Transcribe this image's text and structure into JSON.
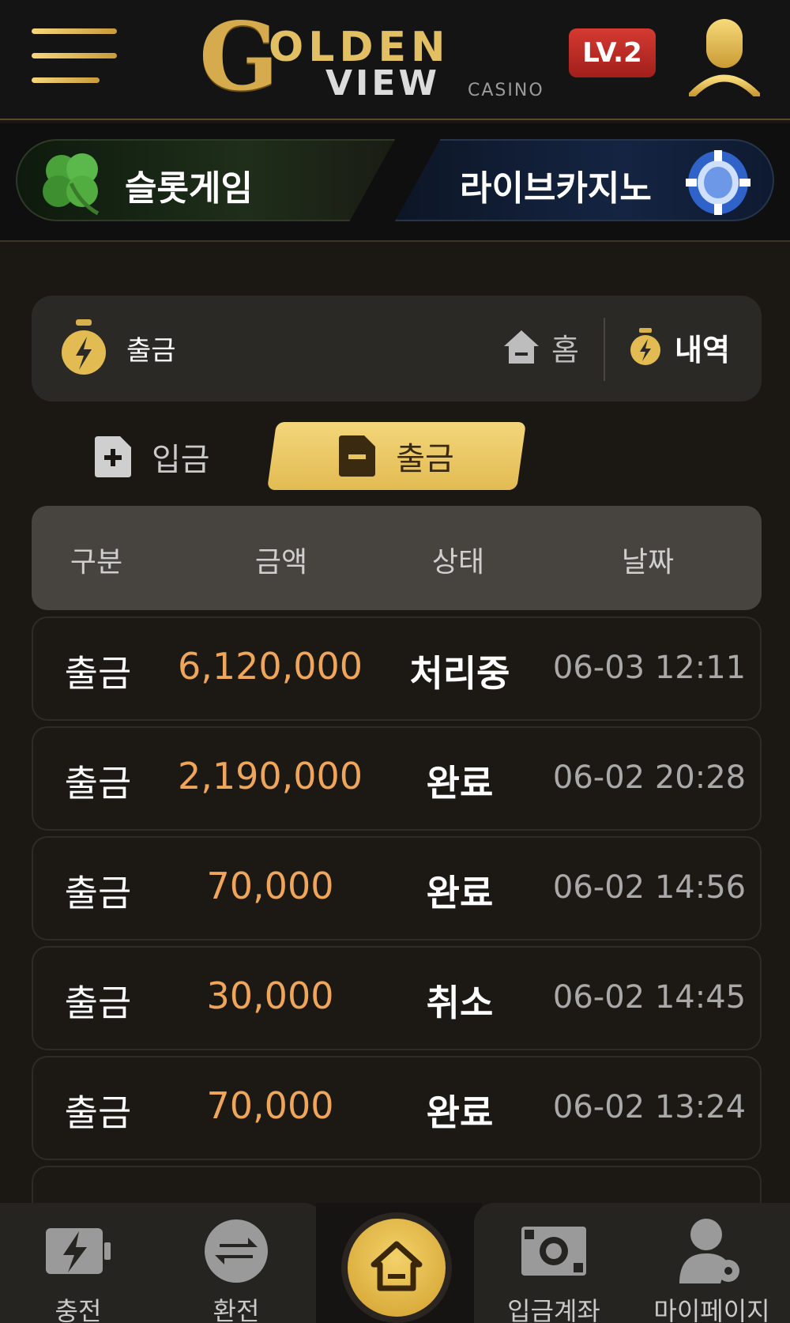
{
  "header": {
    "logo_g": "G",
    "logo_golden": "OLDEN",
    "logo_view": "VIEW",
    "logo_casino": "CASINO",
    "level": "LV.2"
  },
  "games": {
    "slot_label": "슬롯게임",
    "live_label": "라이브카지노"
  },
  "page": {
    "title": "출금",
    "home_label": "홈",
    "history_label": "내역"
  },
  "tabs": {
    "deposit_label": "입금",
    "withdraw_label": "출금"
  },
  "table": {
    "columns": [
      "구분",
      "금액",
      "상태",
      "날짜"
    ],
    "rows": [
      {
        "type": "출금",
        "amount": "6,120,000",
        "status": "처리중",
        "date": "06-03 12:11"
      },
      {
        "type": "출금",
        "amount": "2,190,000",
        "status": "완료",
        "date": "06-02 20:28"
      },
      {
        "type": "출금",
        "amount": "70,000",
        "status": "완료",
        "date": "06-02 14:56"
      },
      {
        "type": "출금",
        "amount": "30,000",
        "status": "취소",
        "date": "06-02 14:45"
      },
      {
        "type": "출금",
        "amount": "70,000",
        "status": "완료",
        "date": "06-02 13:24"
      }
    ]
  },
  "bottom_nav": {
    "charge": "충전",
    "exchange": "환전",
    "deposit_account": "입금계좌",
    "mypage": "마이페이지"
  },
  "colors": {
    "accent_gold": "#e2bb52",
    "amount": "#efa55a",
    "level_badge": "#c42d27"
  }
}
